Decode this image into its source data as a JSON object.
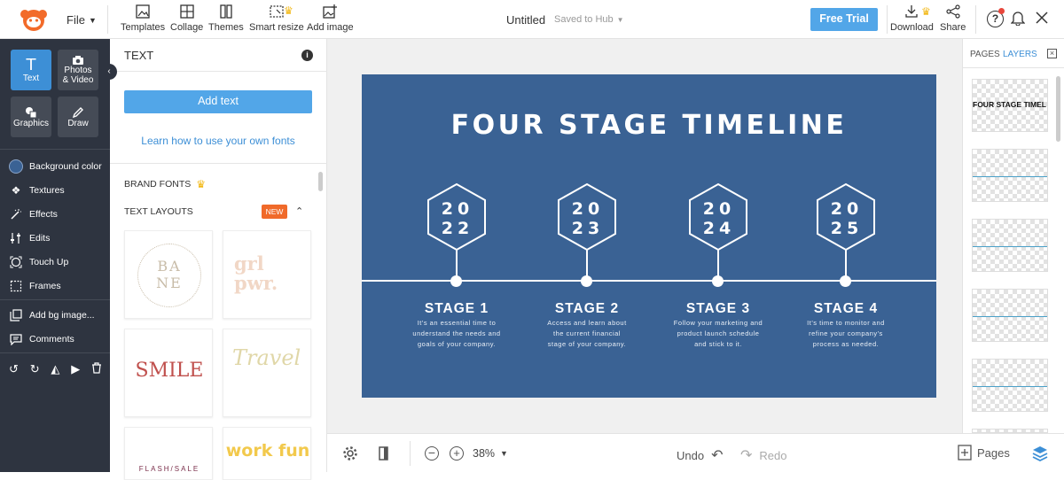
{
  "topbar": {
    "file_label": "File",
    "tools": [
      {
        "label": "Templates"
      },
      {
        "label": "Collage"
      },
      {
        "label": "Themes"
      },
      {
        "label": "Smart resize"
      },
      {
        "label": "Add image"
      }
    ],
    "doc_title": "Untitled",
    "save_status": "Saved to Hub",
    "free_trial": "Free Trial",
    "download": "Download",
    "share": "Share"
  },
  "rail": {
    "buttons": [
      {
        "label": "Text"
      },
      {
        "label": "Photos & Video"
      },
      {
        "label": "Graphics"
      },
      {
        "label": "Draw"
      }
    ],
    "items": [
      {
        "label": "Background color"
      },
      {
        "label": "Textures"
      },
      {
        "label": "Effects"
      },
      {
        "label": "Edits"
      },
      {
        "label": "Touch Up"
      },
      {
        "label": "Frames"
      },
      {
        "label": "Add bg image..."
      },
      {
        "label": "Comments"
      }
    ]
  },
  "panel": {
    "title": "TEXT",
    "add_text": "Add text",
    "learn_fonts": "Learn how to use your own fonts",
    "brand_fonts": "BRAND FONTS",
    "text_layouts": "TEXT LAYOUTS",
    "new_badge": "NEW",
    "layouts": [
      {
        "text": "BA NE"
      },
      {
        "text": "grl pwr."
      },
      {
        "text": "SMILE"
      },
      {
        "text": "Travel"
      },
      {
        "text": "FLASH/SALE"
      },
      {
        "text": "work fun"
      }
    ]
  },
  "design": {
    "title": "FOUR STAGE TIMELINE",
    "stages": [
      {
        "year_top": "20",
        "year_bottom": "22",
        "title": "STAGE 1",
        "desc": [
          "It's an essential time to",
          "understand the needs and",
          "goals of your company."
        ]
      },
      {
        "year_top": "20",
        "year_bottom": "23",
        "title": "STAGE 2",
        "desc": [
          "Access and learn about",
          "the current financial",
          "stage of your company."
        ]
      },
      {
        "year_top": "20",
        "year_bottom": "24",
        "title": "STAGE 3",
        "desc": [
          "Follow your marketing and",
          "product launch schedule",
          "and stick to it."
        ]
      },
      {
        "year_top": "20",
        "year_bottom": "25",
        "title": "STAGE 4",
        "desc": [
          "It's time to monitor and",
          "refine your company's",
          "process as needed."
        ]
      }
    ]
  },
  "bottombar": {
    "zoom": "38%",
    "undo": "Undo",
    "redo": "Redo",
    "pages": "Pages"
  },
  "rpanel": {
    "tab_pages": "PAGES",
    "tab_layers": "LAYERS",
    "first_layer_text": "FOUR STAGE TIMEL"
  },
  "colors": {
    "accent": "#3d8fd6",
    "design_bg": "#3a6294",
    "rail_bg": "#2e3440",
    "new_badge": "#f06a2a"
  }
}
